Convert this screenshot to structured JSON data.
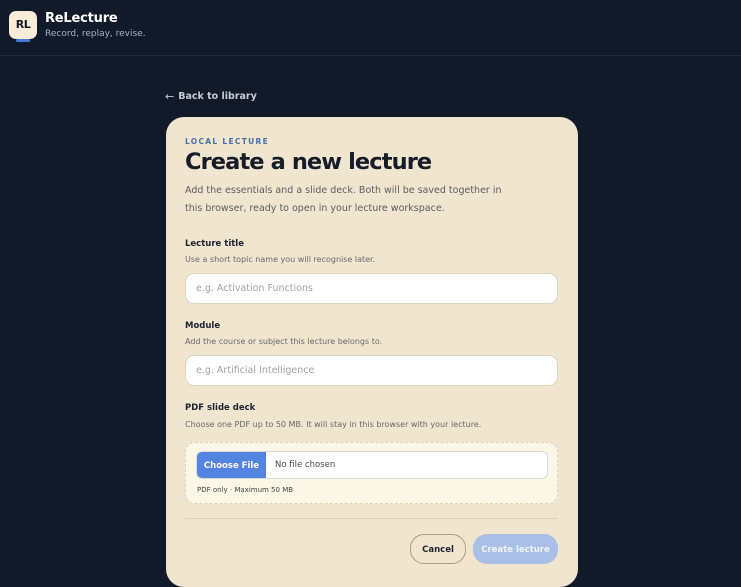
{
  "app": {
    "logo_text": "RL",
    "name": "ReLecture",
    "tagline": "Record, replay, revise."
  },
  "nav": {
    "back_arrow": "←",
    "back_label": "Back to library"
  },
  "form": {
    "eyebrow": "LOCAL LECTURE",
    "title": "Create a new lecture",
    "description": "Add the essentials and a slide deck. Both will be saved together in this browser, ready to open in your lecture workspace.",
    "lecture_title": {
      "label": "Lecture title",
      "help": "Use a short topic name you will recognise later.",
      "placeholder": "e.g. Activation Functions",
      "value": ""
    },
    "module": {
      "label": "Module",
      "help": "Add the course or subject this lecture belongs to.",
      "placeholder": "e.g. Artificial Intelligence",
      "value": ""
    },
    "pdf": {
      "label": "PDF slide deck",
      "help": "Choose one PDF up to 50 MB. It will stay in this browser with your lecture.",
      "choose_label": "Choose File",
      "status": "No file chosen",
      "note": "PDF only · Maximum 50 MB"
    },
    "cancel_label": "Cancel",
    "create_label": "Create lecture"
  },
  "colors": {
    "background": "#121a2a",
    "card": "#f0e6cf",
    "accent": "#5284e0",
    "create_disabled": "#a9bfe6",
    "eyebrow": "#4c6ea8"
  }
}
